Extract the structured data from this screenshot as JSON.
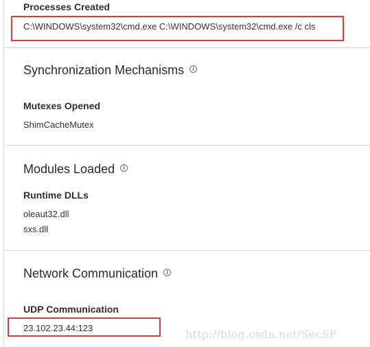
{
  "processes": {
    "heading": "Processes Created",
    "items": [
      "C:\\WINDOWS\\system32\\cmd.exe C:\\WINDOWS\\system32\\cmd.exe /c cls"
    ]
  },
  "sync": {
    "title": "Synchronization Mechanisms",
    "subheading": "Mutexes Opened",
    "items": [
      "ShimCacheMutex"
    ]
  },
  "modules": {
    "title": "Modules Loaded",
    "subheading": "Runtime DLLs",
    "items": [
      "oleaut32.dll",
      "sxs.dll"
    ]
  },
  "network": {
    "title": "Network Communication",
    "subheading": "UDP Communication",
    "items": [
      "23.102.23.44:123"
    ]
  },
  "watermark": "http://blog.csdn.net/SecSF",
  "colors": {
    "highlight": "#e53935",
    "divider": "#dcdcdc"
  },
  "icons": {
    "info": "info-icon"
  }
}
